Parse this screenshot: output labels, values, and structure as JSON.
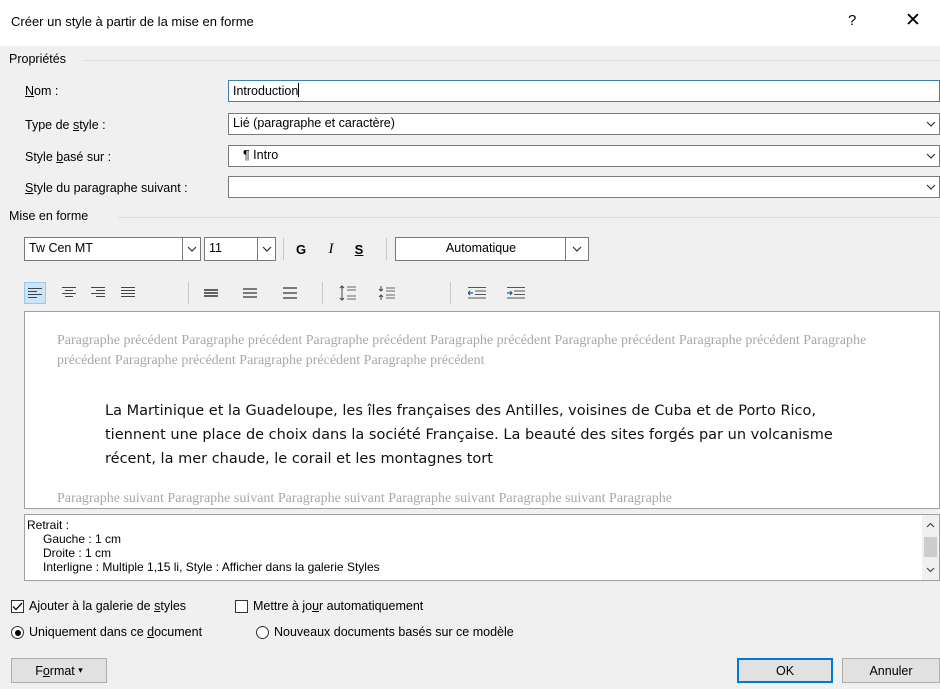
{
  "window": {
    "title": "Créer un style à partir de la mise en forme",
    "help_label": "?",
    "close_label": "✕"
  },
  "properties": {
    "section_label": "Propriétés",
    "name_label": "Nom :",
    "name_value": "Introduction",
    "type_label": "Type de style :",
    "type_value": "Lié (paragraphe et caractère)",
    "based_label": "Style basé sur :",
    "based_value": "¶  Intro",
    "next_label": "Style du paragraphe suivant :",
    "next_value": ""
  },
  "formatting": {
    "section_label": "Mise en forme",
    "font_name": "Tw Cen MT",
    "font_size": "11",
    "bold_label": "G",
    "italic_label": "I",
    "underline_label": "S",
    "color_value": "Automatique"
  },
  "preview": {
    "previous_text": "Paragraphe précédent Paragraphe précédent Paragraphe précédent Paragraphe précédent Paragraphe précédent Paragraphe précédent Paragraphe précédent Paragraphe précédent Paragraphe précédent Paragraphe précédent",
    "main_text": "La Martinique et la Guadeloupe, les îles françaises des Antilles, voisines de Cuba et de Porto Rico, tiennent une place de choix dans la société Française. La beauté des sites forgés par un volcanisme récent, la mer chaude, le corail et les montagnes tort",
    "next_text": "Paragraphe suivant Paragraphe suivant Paragraphe suivant Paragraphe suivant Paragraphe suivant Paragraphe"
  },
  "description": {
    "line1": "Retrait :",
    "line2": "Gauche :  1 cm",
    "line3": "Droite :  1 cm",
    "line4": "Interligne : Multiple 1,15 li, Style : Afficher dans la galerie Styles"
  },
  "options": {
    "add_gallery_label": "Ajouter à la galerie de styles",
    "add_gallery_checked": true,
    "auto_update_label": "Mettre à jour automatiquement",
    "auto_update_checked": false,
    "only_doc_label": "Uniquement dans ce document",
    "new_docs_label": "Nouveaux documents basés sur ce modèle",
    "selected_scope": "only_doc"
  },
  "buttons": {
    "format_label": "Format",
    "ok_label": "OK",
    "cancel_label": "Annuler"
  },
  "colors": {
    "accent": "#0078d7",
    "preview_gray": "#a8a8a8"
  }
}
